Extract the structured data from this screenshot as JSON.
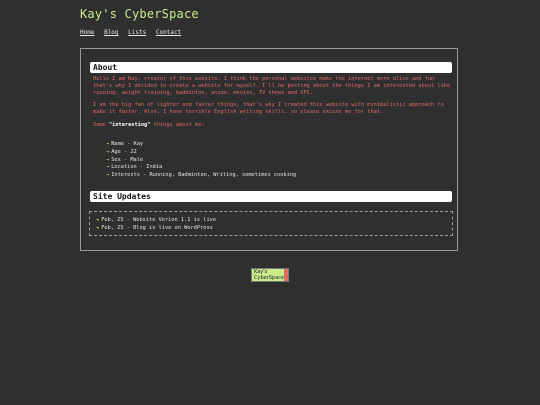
{
  "site": {
    "title": "Kay's CyberSpace"
  },
  "nav": {
    "items": [
      {
        "label": "Home"
      },
      {
        "label": "Blog"
      },
      {
        "label": "Lists"
      },
      {
        "label": "Contact"
      }
    ]
  },
  "about": {
    "heading": "About",
    "paragraph1": "Hello I am Kay, creator of this website. I think the personal websites make the internet more alive and fun that's why I decided to create a website for myself. I'll be posting about the things I am interested about like running, weight training, badminton, anime, movies, TV shows and SFC.",
    "paragraph2": "I am the big fan of lighter and faster things, that's why I created this website with minimalistic approach to make it faster. Also, I have terrible English writing skills, so please excuse me for that.",
    "intro_prefix": "Some ",
    "intro_highlight": "\"interesting\"",
    "intro_suffix": " things about me:",
    "list": [
      {
        "text": "Name - Kay"
      },
      {
        "text": "Age - 22"
      },
      {
        "text": "Sex - Male"
      },
      {
        "text": "Location - India"
      },
      {
        "text": "Interests - Running, Badminton, Writing, sometimes cooking"
      }
    ],
    "arrow": "→"
  },
  "updates": {
    "heading": "Site Updates",
    "arrow": "↠",
    "items": [
      {
        "text": "Feb, 25 - Website Verion 1.1 is live"
      },
      {
        "text": "Feb, 25 - Blog is live on WordPress"
      }
    ]
  },
  "badge": {
    "line1": "Kay's",
    "line2": "CyberSpace"
  },
  "colors": {
    "accent": "#c9ec8a",
    "text_red": "#e06a63",
    "background": "#2f2f2f",
    "border": "#9a9a9a"
  }
}
